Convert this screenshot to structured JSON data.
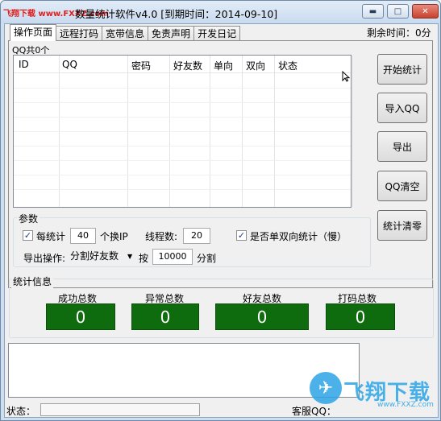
{
  "window": {
    "watermark_text": "飞翔下载 www.FXXZ.com",
    "title": "数量统计软件v4.0 [到期时间：2014-09-10]",
    "minimize_symbol": "▬",
    "maximize_symbol": "□",
    "close_symbol": "✕"
  },
  "tabs": [
    {
      "label": "操作页面",
      "active": true
    },
    {
      "label": "远程打码",
      "active": false
    },
    {
      "label": "宽带信息",
      "active": false
    },
    {
      "label": "免责声明",
      "active": false
    },
    {
      "label": "开发日记",
      "active": false
    }
  ],
  "remaining_time": "剩余时间：0分",
  "table": {
    "count_label": "QQ共0个",
    "columns": [
      "ID",
      "QQ",
      "密码",
      "好友数",
      "单向",
      "双向",
      "状态"
    ],
    "rows": []
  },
  "buttons": {
    "start": "开始统计",
    "import": "导入QQ",
    "export": "导出",
    "clear_qq": "QQ清空",
    "clear_stats": "统计清零"
  },
  "params": {
    "title": "参数",
    "per_count_label": "每统计",
    "per_count_value": "40",
    "switch_ip_label": "个换IP",
    "threads_label": "线程数:",
    "threads_value": "20",
    "single_double_label": "是否单双向统计（慢）",
    "export_op_label": "导出操作:",
    "export_mode": "分割好友数",
    "by_label": "按",
    "split_value": "10000",
    "split_label": "分割",
    "per_count_checked": true,
    "single_double_checked": true
  },
  "stats": {
    "title": "统计信息",
    "items": [
      {
        "label": "成功总数",
        "value": "0"
      },
      {
        "label": "异常总数",
        "value": "0"
      },
      {
        "label": "好友总数",
        "value": "0"
      },
      {
        "label": "打码总数",
        "value": "0"
      }
    ],
    "box_color": "#0e6b0e"
  },
  "status_bar": {
    "status_label": "状态：",
    "support_qq_label": "客服QQ："
  },
  "watermark": {
    "logo_glyph": "✈",
    "brand": "飞翔下载",
    "url": "www.FXXZ.com"
  }
}
